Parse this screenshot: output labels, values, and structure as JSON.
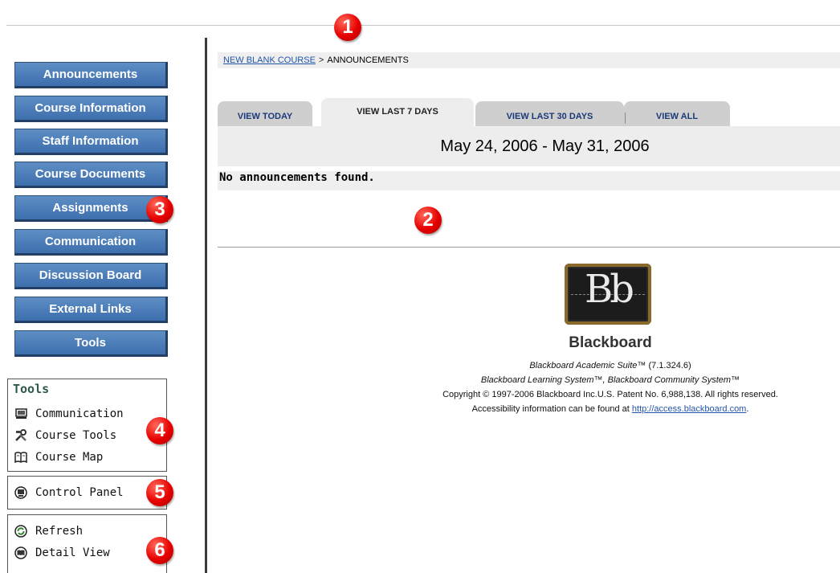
{
  "nav_buttons": [
    {
      "label": "Announcements"
    },
    {
      "label": "Course Information"
    },
    {
      "label": "Staff Information"
    },
    {
      "label": "Course Documents"
    },
    {
      "label": "Assignments"
    },
    {
      "label": "Communication"
    },
    {
      "label": "Discussion Board"
    },
    {
      "label": "External Links"
    },
    {
      "label": "Tools"
    }
  ],
  "tools_box": {
    "title": "Tools",
    "items": [
      {
        "label": "Communication",
        "icon": "monitor-icon"
      },
      {
        "label": "Course Tools",
        "icon": "tools-icon"
      },
      {
        "label": "Course Map",
        "icon": "book-icon"
      }
    ]
  },
  "control_panel": {
    "label": "Control Panel",
    "icon": "control-panel-icon"
  },
  "view_box": {
    "items": [
      {
        "label": "Refresh",
        "icon": "refresh-icon"
      },
      {
        "label": "Detail View",
        "icon": "detail-view-icon"
      }
    ]
  },
  "breadcrumb": {
    "course": "NEW BLANK COURSE",
    "separator": ">",
    "page": "ANNOUNCEMENTS"
  },
  "tabs": [
    {
      "label": "VIEW TODAY",
      "active": false
    },
    {
      "label": "VIEW LAST 7 DAYS",
      "active": true
    },
    {
      "label": "VIEW LAST 30 DAYS",
      "active": false
    },
    {
      "label": "VIEW ALL",
      "active": false
    }
  ],
  "date_range": "May 24, 2006 - May 31, 2006",
  "empty_message": "No announcements found.",
  "footer": {
    "logo_text": "Bb",
    "brand": "Blackboard",
    "line1_italic": "Blackboard Academic Suite™",
    "line1_version": " (7.1.324.6)",
    "line2": "Blackboard Learning System™, Blackboard Community System™",
    "line3": "Copyright © 1997-2006 Blackboard Inc.U.S. Patent No. 6,988,138. All rights reserved.",
    "line4_text": "Accessibility information can be found at ",
    "line4_link": "http://access.blackboard.com",
    "line4_end": "."
  },
  "markers": [
    "1",
    "2",
    "3",
    "4",
    "5",
    "6"
  ],
  "colors": {
    "nav_button": "#3d6fae",
    "marker": "#e60000",
    "link": "#2255aa",
    "tools_title": "#2d5a4a"
  }
}
